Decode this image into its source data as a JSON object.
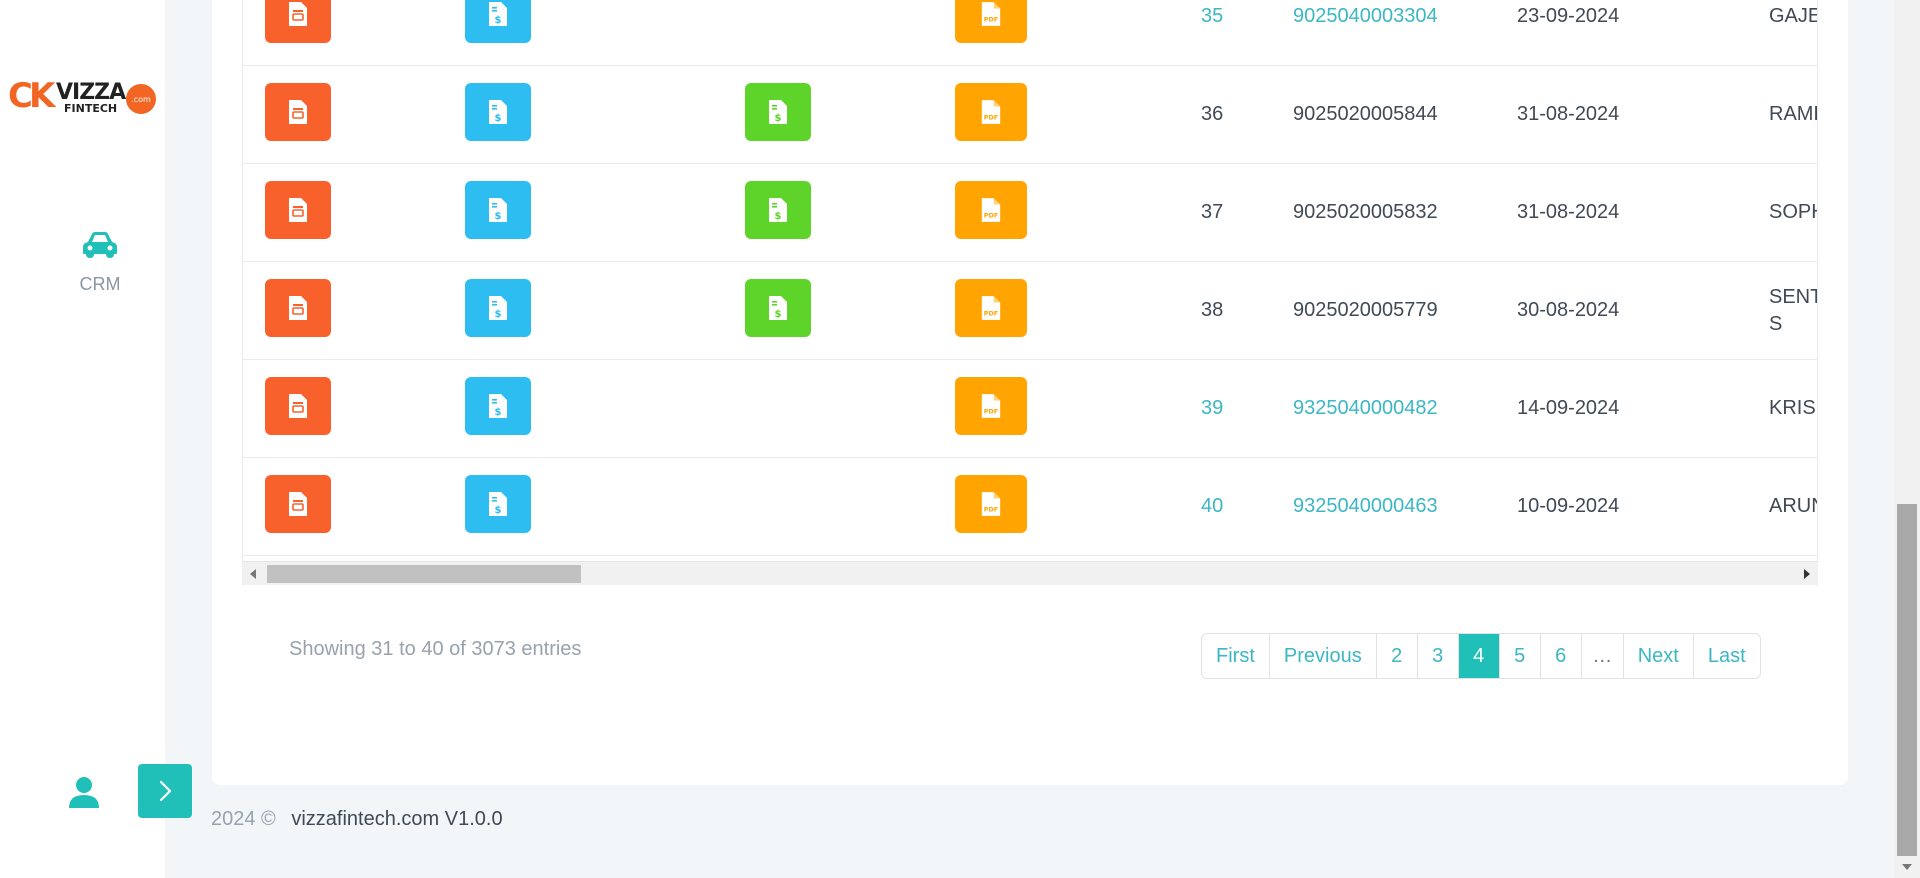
{
  "sidebar": {
    "logo": {
      "mark": "CK",
      "word": "VIZZA",
      "sub": "FINTECH",
      "badge": ".com"
    },
    "nav": [
      {
        "label": "CRM",
        "icon": "car-icon"
      }
    ],
    "bottom": {
      "user_icon": "user-icon",
      "expand_icon": "chevron-right-icon"
    }
  },
  "table": {
    "rows": [
      {
        "num": "35",
        "policy": "9025040003304",
        "date": "23-09-2024",
        "name": "GAJE",
        "linked": true,
        "has_green": false
      },
      {
        "num": "36",
        "policy": "9025020005844",
        "date": "31-08-2024",
        "name": "RAME",
        "linked": false,
        "has_green": true
      },
      {
        "num": "37",
        "policy": "9025020005832",
        "date": "31-08-2024",
        "name": "SOPH",
        "linked": false,
        "has_green": true
      },
      {
        "num": "38",
        "policy": "9025020005779",
        "date": "30-08-2024",
        "name": "SENT",
        "name2": "S",
        "linked": false,
        "has_green": true
      },
      {
        "num": "39",
        "policy": "9325040000482",
        "date": "14-09-2024",
        "name": "KRISH",
        "linked": true,
        "has_green": false
      },
      {
        "num": "40",
        "policy": "9325040000463",
        "date": "10-09-2024",
        "name": "ARUN",
        "linked": true,
        "has_green": false
      }
    ],
    "icons": {
      "orange": "document-icon",
      "blue": "invoice-icon",
      "green": "payment-receipt-icon",
      "pdf": "pdf-file-icon"
    },
    "colors": {
      "orange": "#f8612c",
      "blue": "#2ebdf0",
      "green": "#5ed32a",
      "pdf": "#ffa400",
      "link": "#3bb7c4"
    }
  },
  "pagination": {
    "info": "Showing 31 to 40 of 3073 entries",
    "first": "First",
    "previous": "Previous",
    "pages": [
      "2",
      "3",
      "4",
      "5",
      "6"
    ],
    "active": "4",
    "ellipsis": "…",
    "next": "Next",
    "last": "Last"
  },
  "footer": {
    "year": "2024 ©",
    "site": "vizzafintech.com V1.0.0"
  }
}
